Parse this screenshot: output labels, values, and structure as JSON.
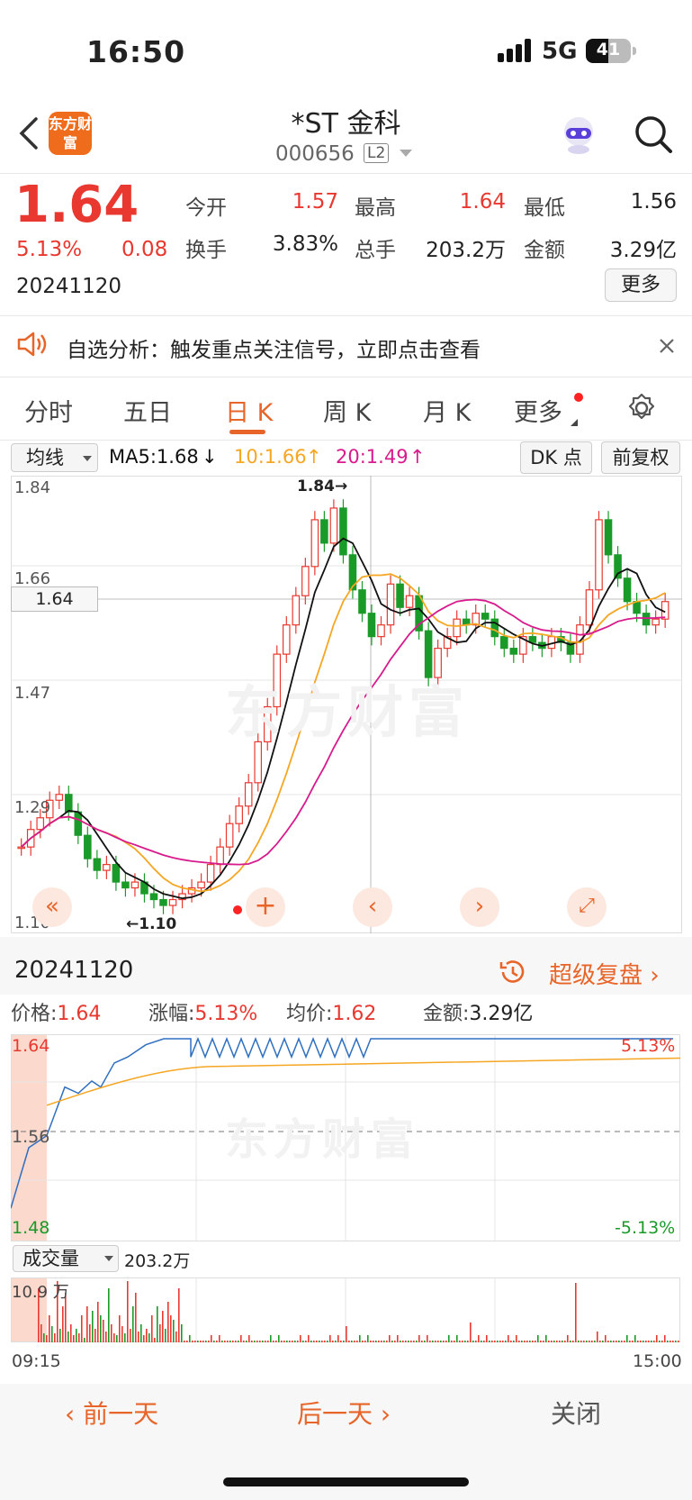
{
  "status": {
    "time": "16:50",
    "network": "5G",
    "battery": "41"
  },
  "header": {
    "logo_text": "东方财富",
    "title": "*ST 金科",
    "code": "000656",
    "level": "L2"
  },
  "quote": {
    "price": "1.64",
    "change_pct": "5.13%",
    "change": "0.08",
    "date": "20241120",
    "fields": [
      {
        "label": "今开",
        "value": "1.57"
      },
      {
        "label": "最高",
        "value": "1.64"
      },
      {
        "label": "最低",
        "value": "1.56"
      },
      {
        "label": "换手",
        "value": "3.83%"
      },
      {
        "label": "总手",
        "value": "203.2万"
      },
      {
        "label": "金额",
        "value": "3.29亿"
      }
    ],
    "more": "更多"
  },
  "notice": {
    "text": "自选分析：触发重点关注信号，立即点击查看"
  },
  "tabs": [
    "分时",
    "五日",
    "日 K",
    "周 K",
    "月 K",
    "更多"
  ],
  "kline_bar": {
    "indicator": "均线",
    "ma5": "MA5:1.68",
    "ma10": "10:1.66",
    "ma20": "20:1.49",
    "dk": "DK 点",
    "adj": "前复权"
  },
  "kline": {
    "y_ticks": [
      "1.84",
      "1.66",
      "1.47",
      "1.29",
      "1.10"
    ],
    "cursor": "1.64",
    "high_mark": "1.84",
    "low_mark": "1.10",
    "watermark": "东方财富"
  },
  "intraday": {
    "date": "20241120",
    "replay": "超级复盘",
    "price_label": "价格:",
    "price": "1.64",
    "chg_label": "涨幅:",
    "chg": "5.13%",
    "avg_label": "均价:",
    "avg": "1.62",
    "amt_label": "金额:",
    "amt": "3.29亿",
    "y_top": "1.64",
    "y_mid": "1.56",
    "y_bot": "1.48",
    "pct_top": "5.13%",
    "pct_bot": "-5.13%",
    "vol_label": "成交量",
    "vol_total": "203.2万",
    "vol_max": "10.9 万",
    "t_start": "09:15",
    "t_end": "15:00"
  },
  "footer": {
    "prev": "前一天",
    "next": "后一天",
    "close": "关闭"
  },
  "colors": {
    "up": "#e8382f",
    "down": "#1a9a28",
    "ma5": "#111111",
    "ma10": "#f5a623",
    "ma20": "#d81b8c",
    "accent": "#e8652a",
    "line": "#2f6fc0",
    "avg": "#f5a623"
  }
}
